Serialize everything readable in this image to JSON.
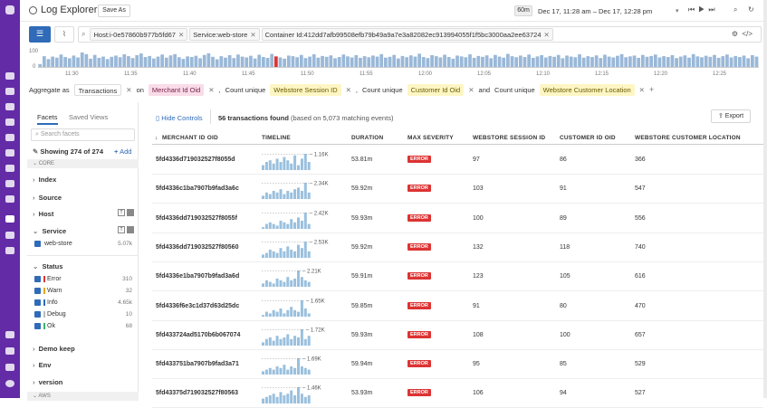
{
  "header": {
    "title": "Log Explorer",
    "save_as": "Save As",
    "time_badge": "60m",
    "time_range": "Dec 17, 11:28 am – Dec 17, 12:28 pm"
  },
  "query": {
    "chips": [
      "Host:i-0e57860b977b5fd67",
      "Service:web-store",
      "Container Id:412dd7afb99508efb79b49a9a7e3a82082ec913994055f1f5bc3000aa2ee63724"
    ]
  },
  "histogram": {
    "y_max": "100",
    "y_min": "0",
    "times": [
      "11:30",
      "11:35",
      "11:40",
      "11:45",
      "11:50",
      "11:55",
      "12:00",
      "12:05",
      "12:10",
      "12:15",
      "12:20",
      "12:25"
    ],
    "bars": [
      14,
      52,
      38,
      50,
      45,
      60,
      48,
      42,
      55,
      46,
      70,
      62,
      40,
      58,
      44,
      50,
      38,
      49,
      55,
      47,
      61,
      52,
      43,
      57,
      65,
      48,
      53,
      41,
      50,
      60,
      45,
      56,
      62,
      47,
      39,
      51,
      48,
      54,
      42,
      58,
      66,
      49,
      37,
      52,
      45,
      57,
      43,
      60,
      50,
      46,
      54,
      41,
      59,
      48,
      44,
      63,
      51,
      46,
      40,
      55,
      52,
      47,
      58,
      43,
      50,
      61,
      45,
      53,
      49,
      56,
      42,
      48,
      60,
      51,
      46,
      57,
      44,
      52,
      47,
      55,
      50,
      62,
      45,
      49,
      58,
      41,
      53,
      47,
      56,
      50,
      64,
      48,
      43,
      57,
      52,
      46,
      59,
      48,
      40,
      55,
      51,
      47,
      61,
      44,
      53,
      49,
      56,
      42,
      58,
      50,
      45,
      63,
      52,
      47,
      55,
      48,
      60,
      44,
      51,
      57,
      46,
      53,
      49,
      58,
      42,
      55,
      50,
      47,
      61,
      45,
      52,
      48,
      56,
      43,
      59,
      50,
      46,
      54,
      62,
      47,
      51,
      55,
      44,
      58,
      49,
      53,
      60,
      46,
      52,
      48,
      57,
      43,
      50,
      56,
      45,
      62,
      51,
      47,
      54,
      49,
      58,
      44,
      52,
      60,
      46,
      53,
      48,
      55,
      42,
      57,
      50
    ]
  },
  "aggregate": {
    "prefix": "Aggregate as",
    "type": "Transactions",
    "on": "on",
    "field": "Merchant Id Oid",
    "c1": "Count unique",
    "f1": "Webstore Session ID",
    "c2": "Count unique",
    "f2": "Customer Id Oid",
    "and": "and",
    "c3": "Count unique",
    "f3": "Webstore Customer Location",
    "comma": ","
  },
  "sidebar": {
    "tab_facets": "Facets",
    "tab_saved": "Saved Views",
    "search_placeholder": "Search facets",
    "showing": "Showing 274 of 274",
    "add": "Add",
    "core": "CORE",
    "aws": "AWS",
    "index": "Index",
    "source": "Source",
    "host": "Host",
    "service": "Service",
    "service_value": "web-store",
    "service_count": "5.07k",
    "status": "Status",
    "statuses": [
      {
        "label": "Error",
        "count": "310",
        "color": "#d33"
      },
      {
        "label": "Warn",
        "count": "32",
        "color": "#e8a400"
      },
      {
        "label": "Info",
        "count": "4.65k",
        "color": "#2f6bb8"
      },
      {
        "label": "Debug",
        "count": "10",
        "color": "#bbbbbb"
      },
      {
        "label": "Ok",
        "count": "68",
        "color": "#3bb26f"
      }
    ],
    "demo_keep": "Demo keep",
    "env": "Env",
    "version": "version"
  },
  "main": {
    "hide_controls": "Hide Controls",
    "found": "56 transactions found",
    "based": "(based on 5,073 matching events)",
    "export": "Export",
    "columns": [
      "MERCHANT ID OID",
      "TIMELINE",
      "DURATION",
      "MAX SEVERITY",
      "WEBSTORE SESSION ID",
      "CUSTOMER ID OID",
      "WEBSTORE CUSTOMER LOCATION"
    ]
  },
  "rows": [
    {
      "id": "5fd4336d719032527f8055d",
      "peak": "1.16K",
      "duration": "53.81m",
      "severity": "ERROR",
      "session": "97",
      "customer": "86",
      "location": "366",
      "spark": [
        3,
        5,
        6,
        4,
        7,
        5,
        8,
        6,
        4,
        9,
        3,
        7,
        10,
        5
      ]
    },
    {
      "id": "5fd4336c1ba7907b9fad3a6c",
      "peak": "2.34K",
      "duration": "59.92m",
      "severity": "ERROR",
      "session": "103",
      "customer": "91",
      "location": "547",
      "spark": [
        2,
        4,
        3,
        5,
        4,
        6,
        3,
        5,
        4,
        6,
        7,
        5,
        10,
        4
      ]
    },
    {
      "id": "5fd4336dd719032527f8055f",
      "peak": "2.42K",
      "duration": "59.93m",
      "severity": "ERROR",
      "session": "100",
      "customer": "89",
      "location": "556",
      "spark": [
        1,
        3,
        4,
        3,
        2,
        5,
        4,
        3,
        6,
        4,
        7,
        5,
        10,
        3
      ]
    },
    {
      "id": "5fd4336dd719032527f80560",
      "peak": "2.53K",
      "duration": "59.92m",
      "severity": "ERROR",
      "session": "132",
      "customer": "118",
      "location": "740",
      "spark": [
        2,
        3,
        5,
        4,
        3,
        6,
        4,
        7,
        5,
        4,
        8,
        6,
        10,
        4
      ]
    },
    {
      "id": "5fd4336e1ba7907b9fad3a6d",
      "peak": "2.21K",
      "duration": "59.91m",
      "severity": "ERROR",
      "session": "123",
      "customer": "105",
      "location": "616",
      "spark": [
        2,
        4,
        3,
        2,
        5,
        4,
        3,
        6,
        4,
        5,
        10,
        6,
        4,
        3
      ]
    },
    {
      "id": "5fd4336f6e3c1d37d63d25dc",
      "peak": "1.65K",
      "duration": "59.85m",
      "severity": "ERROR",
      "session": "91",
      "customer": "80",
      "location": "470",
      "spark": [
        1,
        3,
        2,
        4,
        3,
        5,
        2,
        4,
        6,
        4,
        3,
        10,
        5,
        2
      ]
    },
    {
      "id": "5fd433724ad5170b6b067074",
      "peak": "1.72K",
      "duration": "59.93m",
      "severity": "ERROR",
      "session": "108",
      "customer": "100",
      "location": "657",
      "spark": [
        2,
        4,
        5,
        3,
        6,
        4,
        5,
        7,
        4,
        6,
        5,
        10,
        4,
        6
      ]
    },
    {
      "id": "5fd433751ba7907b9fad3a71",
      "peak": "1.69K",
      "duration": "59.94m",
      "severity": "ERROR",
      "session": "95",
      "customer": "85",
      "location": "529",
      "spark": [
        2,
        3,
        4,
        3,
        5,
        4,
        6,
        3,
        5,
        4,
        10,
        5,
        4,
        3
      ]
    },
    {
      "id": "5fd43375d719032527f80563",
      "peak": "1.46K",
      "duration": "53.93m",
      "severity": "ERROR",
      "session": "106",
      "customer": "94",
      "location": "527",
      "spark": [
        3,
        4,
        5,
        6,
        4,
        7,
        5,
        6,
        8,
        5,
        10,
        6,
        4,
        5
      ]
    }
  ]
}
